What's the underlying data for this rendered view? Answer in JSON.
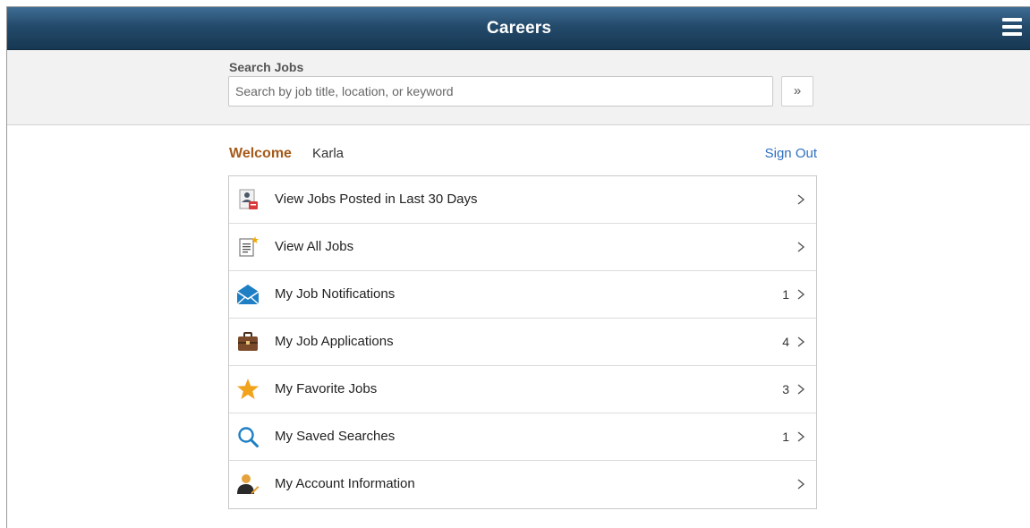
{
  "header": {
    "title": "Careers",
    "menu_icon": "hamburger-menu-icon"
  },
  "search": {
    "label": "Search Jobs",
    "placeholder": "Search by job title, location, or keyword",
    "value": "",
    "go_label": "»"
  },
  "welcome": {
    "greeting": "Welcome",
    "user": "Karla",
    "sign_out": "Sign Out"
  },
  "colors": {
    "header_top": "#3f6d94",
    "header_bottom": "#163852",
    "welcome": "#a55b1a",
    "link": "#2e6fbf"
  },
  "menu": {
    "items": [
      {
        "label": "View Jobs Posted in Last 30 Days",
        "count": "",
        "icon": "recent-jobs-icon"
      },
      {
        "label": "View All Jobs",
        "count": "",
        "icon": "all-jobs-icon"
      },
      {
        "label": "My Job Notifications",
        "count": "1",
        "icon": "envelope-icon"
      },
      {
        "label": "My Job Applications",
        "count": "4",
        "icon": "briefcase-icon"
      },
      {
        "label": "My Favorite Jobs",
        "count": "3",
        "icon": "star-icon"
      },
      {
        "label": "My Saved Searches",
        "count": "1",
        "icon": "magnifier-icon"
      },
      {
        "label": "My Account Information",
        "count": "",
        "icon": "account-person-icon"
      }
    ]
  }
}
